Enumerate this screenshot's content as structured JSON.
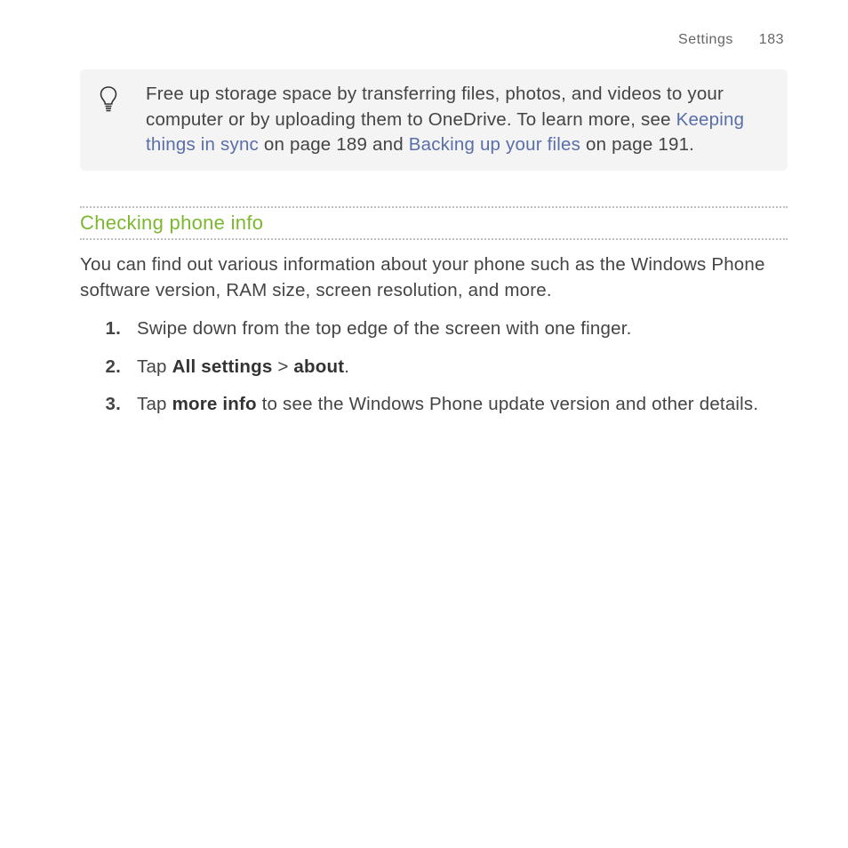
{
  "header": {
    "section": "Settings",
    "page": "183"
  },
  "tip": {
    "before_link1": "Free up storage space by transferring files, photos, and videos to your computer or by uploading them to OneDrive. To learn more, see ",
    "link1": "Keeping things in sync",
    "between_links": " on page 189 and ",
    "link2": "Backing up your files",
    "after_link2": " on page 191."
  },
  "section": {
    "heading": "Checking phone info"
  },
  "intro": "You can find out various information about your phone such as the Windows Phone software version, RAM size, screen resolution, and more.",
  "steps": [
    {
      "num": "1.",
      "text": "Swipe down from the top edge of the screen with one finger."
    },
    {
      "num": "2.",
      "pre": "Tap ",
      "b1": "All settings",
      "mid": " > ",
      "b2": "about",
      "post": "."
    },
    {
      "num": "3.",
      "pre": "Tap ",
      "b1": "more info",
      "post": " to see the Windows Phone update version and other details."
    }
  ]
}
